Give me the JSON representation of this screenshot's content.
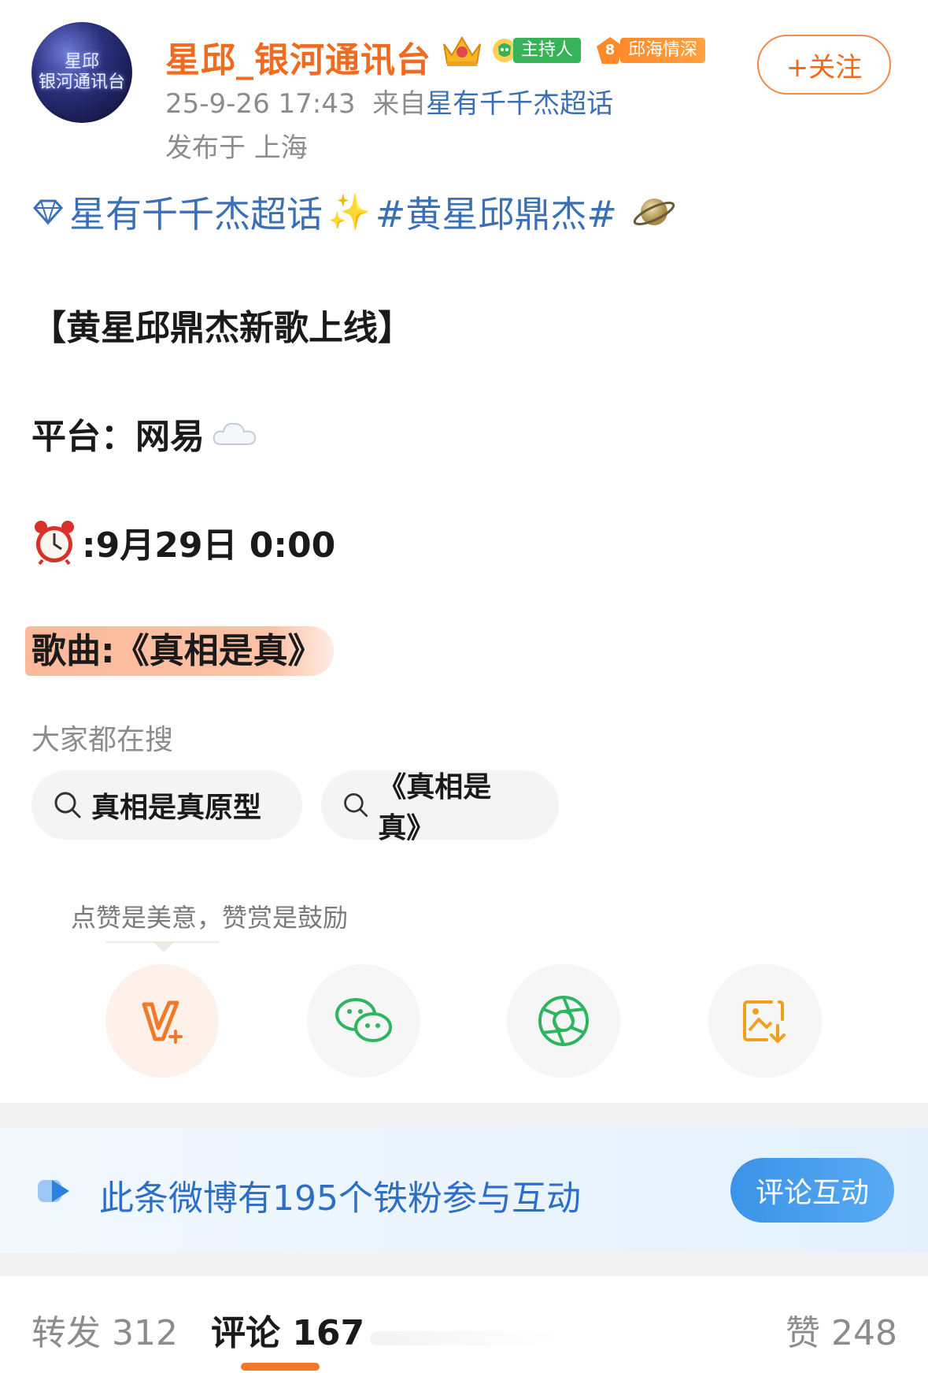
{
  "header": {
    "username": "星邱_银河通讯台",
    "avatar_text": "星邱\n银河通讯台",
    "badge_host": "主持人",
    "badge_fan_level": "8",
    "badge_fan": "邱海情深",
    "follow_label": "+关注",
    "time": "25-9-26 17:43",
    "from_prefix": "来自",
    "source": "星有千千杰超话",
    "location": "发布于 上海"
  },
  "post": {
    "topic": "星有千千杰超话",
    "hashtag": "#黄星邱鼎杰#",
    "title_line": "【黄星邱鼎杰新歌上线】",
    "platform_line": "平台：网易",
    "time_line": ":9月29日 0:00",
    "song_line": "歌曲:《真相是真》"
  },
  "search": {
    "title": "大家都在搜",
    "chips": [
      "真相是真原型",
      "《真相是真》"
    ]
  },
  "reward": {
    "tip": "点赞是美意，赞赏是鼓励"
  },
  "fans": {
    "text": "此条微博有195个铁粉参与互动",
    "button": "评论互动"
  },
  "tabs": {
    "repost": "转发 312",
    "comment": "评论 167",
    "like": "赞 248"
  },
  "colors": {
    "username": "#f06a1f",
    "link": "#3b6fb6",
    "accent": "#f07a2a",
    "fan_button": "#3b93e8"
  }
}
